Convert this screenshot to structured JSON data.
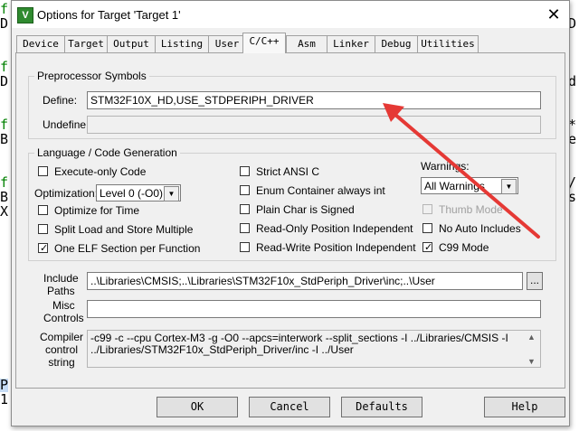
{
  "background": {
    "left_chars": [
      "f",
      "D",
      "",
      "",
      "f",
      "D",
      "",
      "",
      "f",
      "B",
      "",
      "",
      "f",
      "B",
      "X",
      "",
      "",
      "",
      "",
      "",
      "",
      "",
      "",
      "",
      "",
      "",
      "P",
      "1"
    ],
    "right_chars": [
      "",
      "D",
      "",
      "",
      "",
      "d",
      "",
      "",
      "*",
      "e",
      "",
      "",
      "/",
      "s"
    ]
  },
  "window": {
    "title": "Options for Target 'Target 1'",
    "app_icon_glyph": "V",
    "close_glyph": "✕"
  },
  "tabs": [
    "Device",
    "Target",
    "Output",
    "Listing",
    "User",
    "C/C++",
    "Asm",
    "Linker",
    "Debug",
    "Utilities"
  ],
  "active_tab": "C/C++",
  "preprocessor": {
    "group_title": "Preprocessor Symbols",
    "define_label": "Define:",
    "define_value": "STM32F10X_HD,USE_STDPERIPH_DRIVER",
    "undefine_label": "Undefine:",
    "undefine_value": ""
  },
  "language": {
    "group_title": "Language / Code Generation",
    "execute_only": {
      "label": "Execute-only Code",
      "checked": false
    },
    "optimization_label": "Optimization:",
    "optimization_value": "Level 0 (-O0)",
    "optimize_time": {
      "label": "Optimize for Time",
      "checked": false
    },
    "split_load": {
      "label": "Split Load and Store Multiple",
      "checked": false
    },
    "one_elf": {
      "label": "One ELF Section per Function",
      "checked": true
    },
    "strict_ansi": {
      "label": "Strict ANSI C",
      "checked": false
    },
    "enum_container": {
      "label": "Enum Container always int",
      "checked": false
    },
    "plain_char": {
      "label": "Plain Char is Signed",
      "checked": false
    },
    "ro_independent": {
      "label": "Read-Only Position Independent",
      "checked": false
    },
    "rw_independent": {
      "label": "Read-Write Position Independent",
      "checked": false
    },
    "warnings_label": "Warnings:",
    "warnings_value": "All Warnings",
    "thumb_mode": {
      "label": "Thumb Mode",
      "checked": false
    },
    "no_auto_includes": {
      "label": "No Auto Includes",
      "checked": false
    },
    "c99_mode": {
      "label": "C99 Mode",
      "checked": true
    }
  },
  "include": {
    "label_line1": "Include",
    "label_line2": "Paths",
    "value": "..\\Libraries\\CMSIS;..\\Libraries\\STM32F10x_StdPeriph_Driver\\inc;..\\User",
    "browse_label": "..."
  },
  "misc": {
    "label_line1": "Misc",
    "label_line2": "Controls",
    "value": ""
  },
  "compiler": {
    "label_line1": "Compiler",
    "label_line2": "control",
    "label_line3": "string",
    "line1": "-c99 -c --cpu Cortex-M3 -g -O0 --apcs=interwork --split_sections -I ../Libraries/CMSIS -I",
    "line2": "../Libraries/STM32F10x_StdPeriph_Driver/inc -I ../User",
    "scroll_up": "▲",
    "scroll_down": "▼"
  },
  "buttons": {
    "ok": "OK",
    "cancel": "Cancel",
    "defaults": "Defaults",
    "help": "Help"
  },
  "colors": {
    "annotation_arrow": "#e53935",
    "editor_green": "#008000",
    "highlight": "#c6dcf5"
  }
}
